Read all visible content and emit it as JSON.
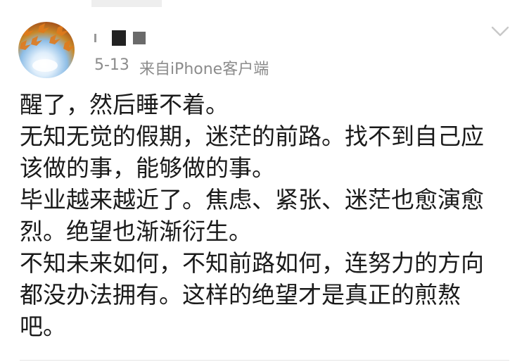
{
  "post": {
    "time": "5-13",
    "source": "来自iPhone客户端",
    "lines": [
      "醒了，然后睡不着。",
      "无知无觉的假期，迷茫的前路。找不到自己应",
      "该做的事，能够做的事。",
      "毕业越来越近了。焦虑、紧张、迷茫也愈演愈",
      "烈。绝望也渐渐衍生。",
      "不知未来如何，不知前路如何，连努力的方向",
      "都没办法拥有。这样的绝望才是真正的煎熬",
      "吧。"
    ]
  },
  "icons": {
    "menu": "chevron-down-icon",
    "avatar": "autumn-leaves-avatar"
  },
  "colors": {
    "text": "#1a1a1a",
    "meta": "#8c8c8c",
    "chevron": "#c8c8c8"
  }
}
